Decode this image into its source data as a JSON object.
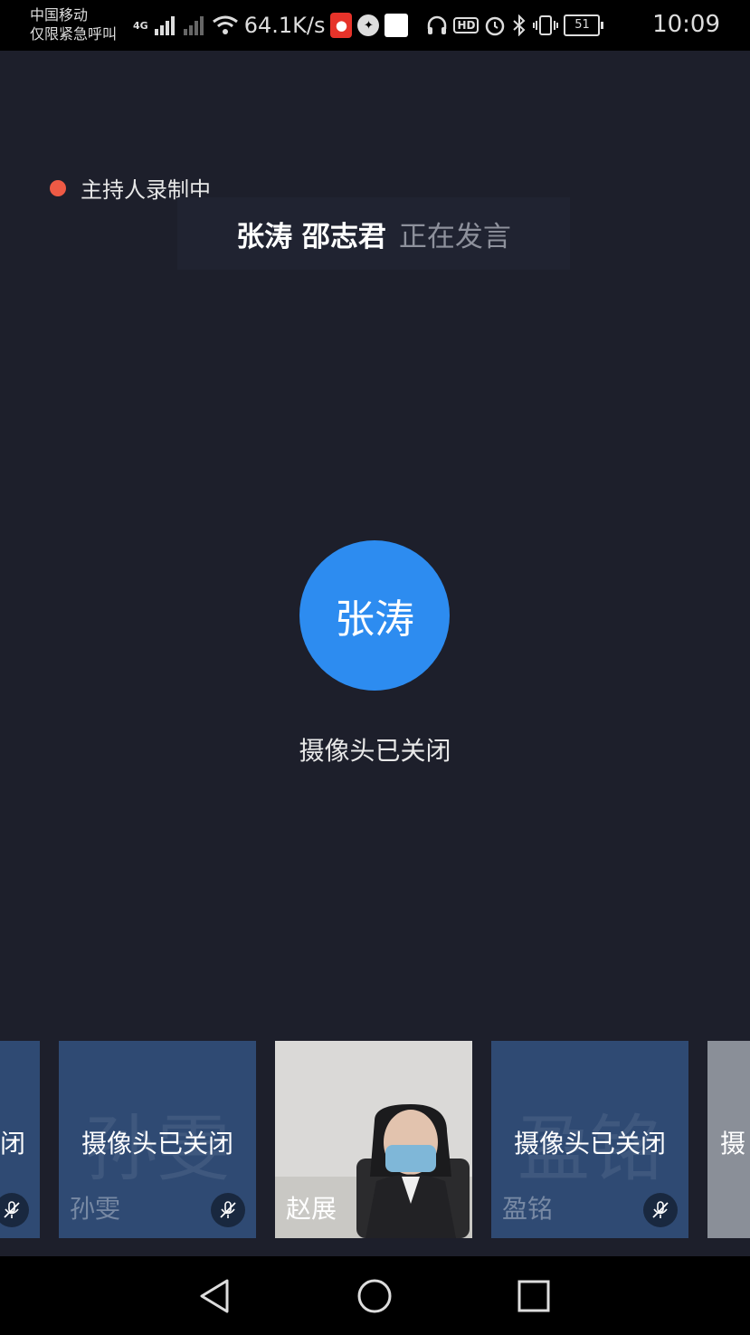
{
  "status_bar": {
    "carrier_line1": "中国移动",
    "carrier_line2": "仅限紧急呼叫",
    "network_type": "4G",
    "speed": "64.1K/s",
    "battery": "51",
    "time": "10:09"
  },
  "meeting": {
    "recording_label": "主持人录制中",
    "speaking_names": "张涛 邵志君",
    "speaking_status": "正在发言",
    "main_avatar_name": "张涛",
    "main_camera_status": "摄像头已关闭"
  },
  "participants": [
    {
      "name": "",
      "status": "闭",
      "muted": true
    },
    {
      "name": "孙雯",
      "status": "摄像头已关闭",
      "muted": true
    },
    {
      "name": "赵展",
      "status": "",
      "video": true
    },
    {
      "name": "盈铭",
      "status": "摄像头已关闭",
      "muted": true
    },
    {
      "name": "",
      "status": "摄",
      "video": true
    }
  ],
  "colors": {
    "background": "#1d1f2b",
    "avatar": "#2d8cf0",
    "tile": "#2f4a73",
    "record_dot": "#ee5a45"
  },
  "icons": {
    "back": "back-triangle-icon",
    "home": "home-circle-icon",
    "recents": "recents-square-icon",
    "mute": "mic-muted-icon"
  }
}
